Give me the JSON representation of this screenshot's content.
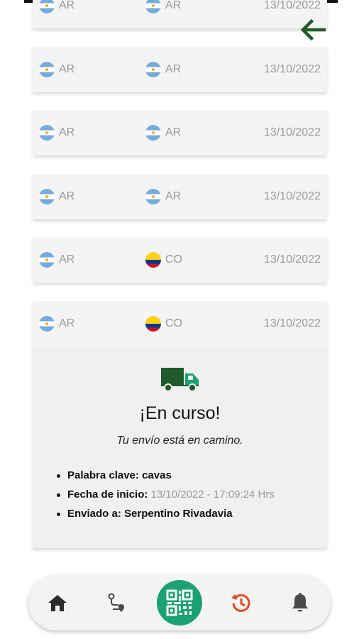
{
  "colors": {
    "accent_green": "#1aa272",
    "dark_green": "#1f5a2a",
    "history_red": "#e0491f",
    "muted_text": "#9a9a9a"
  },
  "shipments": [
    {
      "from": "AR",
      "to": "AR",
      "date": "13/10/2022"
    },
    {
      "from": "AR",
      "to": "AR",
      "date": "13/10/2022"
    },
    {
      "from": "AR",
      "to": "AR",
      "date": "13/10/2022"
    },
    {
      "from": "AR",
      "to": "AR",
      "date": "13/10/2022"
    },
    {
      "from": "AR",
      "to": "CO",
      "date": "13/10/2022"
    },
    {
      "from": "AR",
      "to": "CO",
      "date": "13/10/2022"
    }
  ],
  "detail": {
    "icon": "truck-icon",
    "title": "¡En curso!",
    "subtitle": "Tu envío está en camino.",
    "keyword_label": "Palabra clave:",
    "keyword_value": "cavas",
    "start_label": "Fecha de inicio:",
    "start_value": "13/10/2022 - 17:09:24 Hrs",
    "sent_to_label": "Enviado a:",
    "sent_to_value": "Serpentino Rivadavia"
  },
  "nav": {
    "items": [
      "home-icon",
      "route-icon",
      "qr-code-icon",
      "history-icon",
      "bell-icon"
    ]
  }
}
